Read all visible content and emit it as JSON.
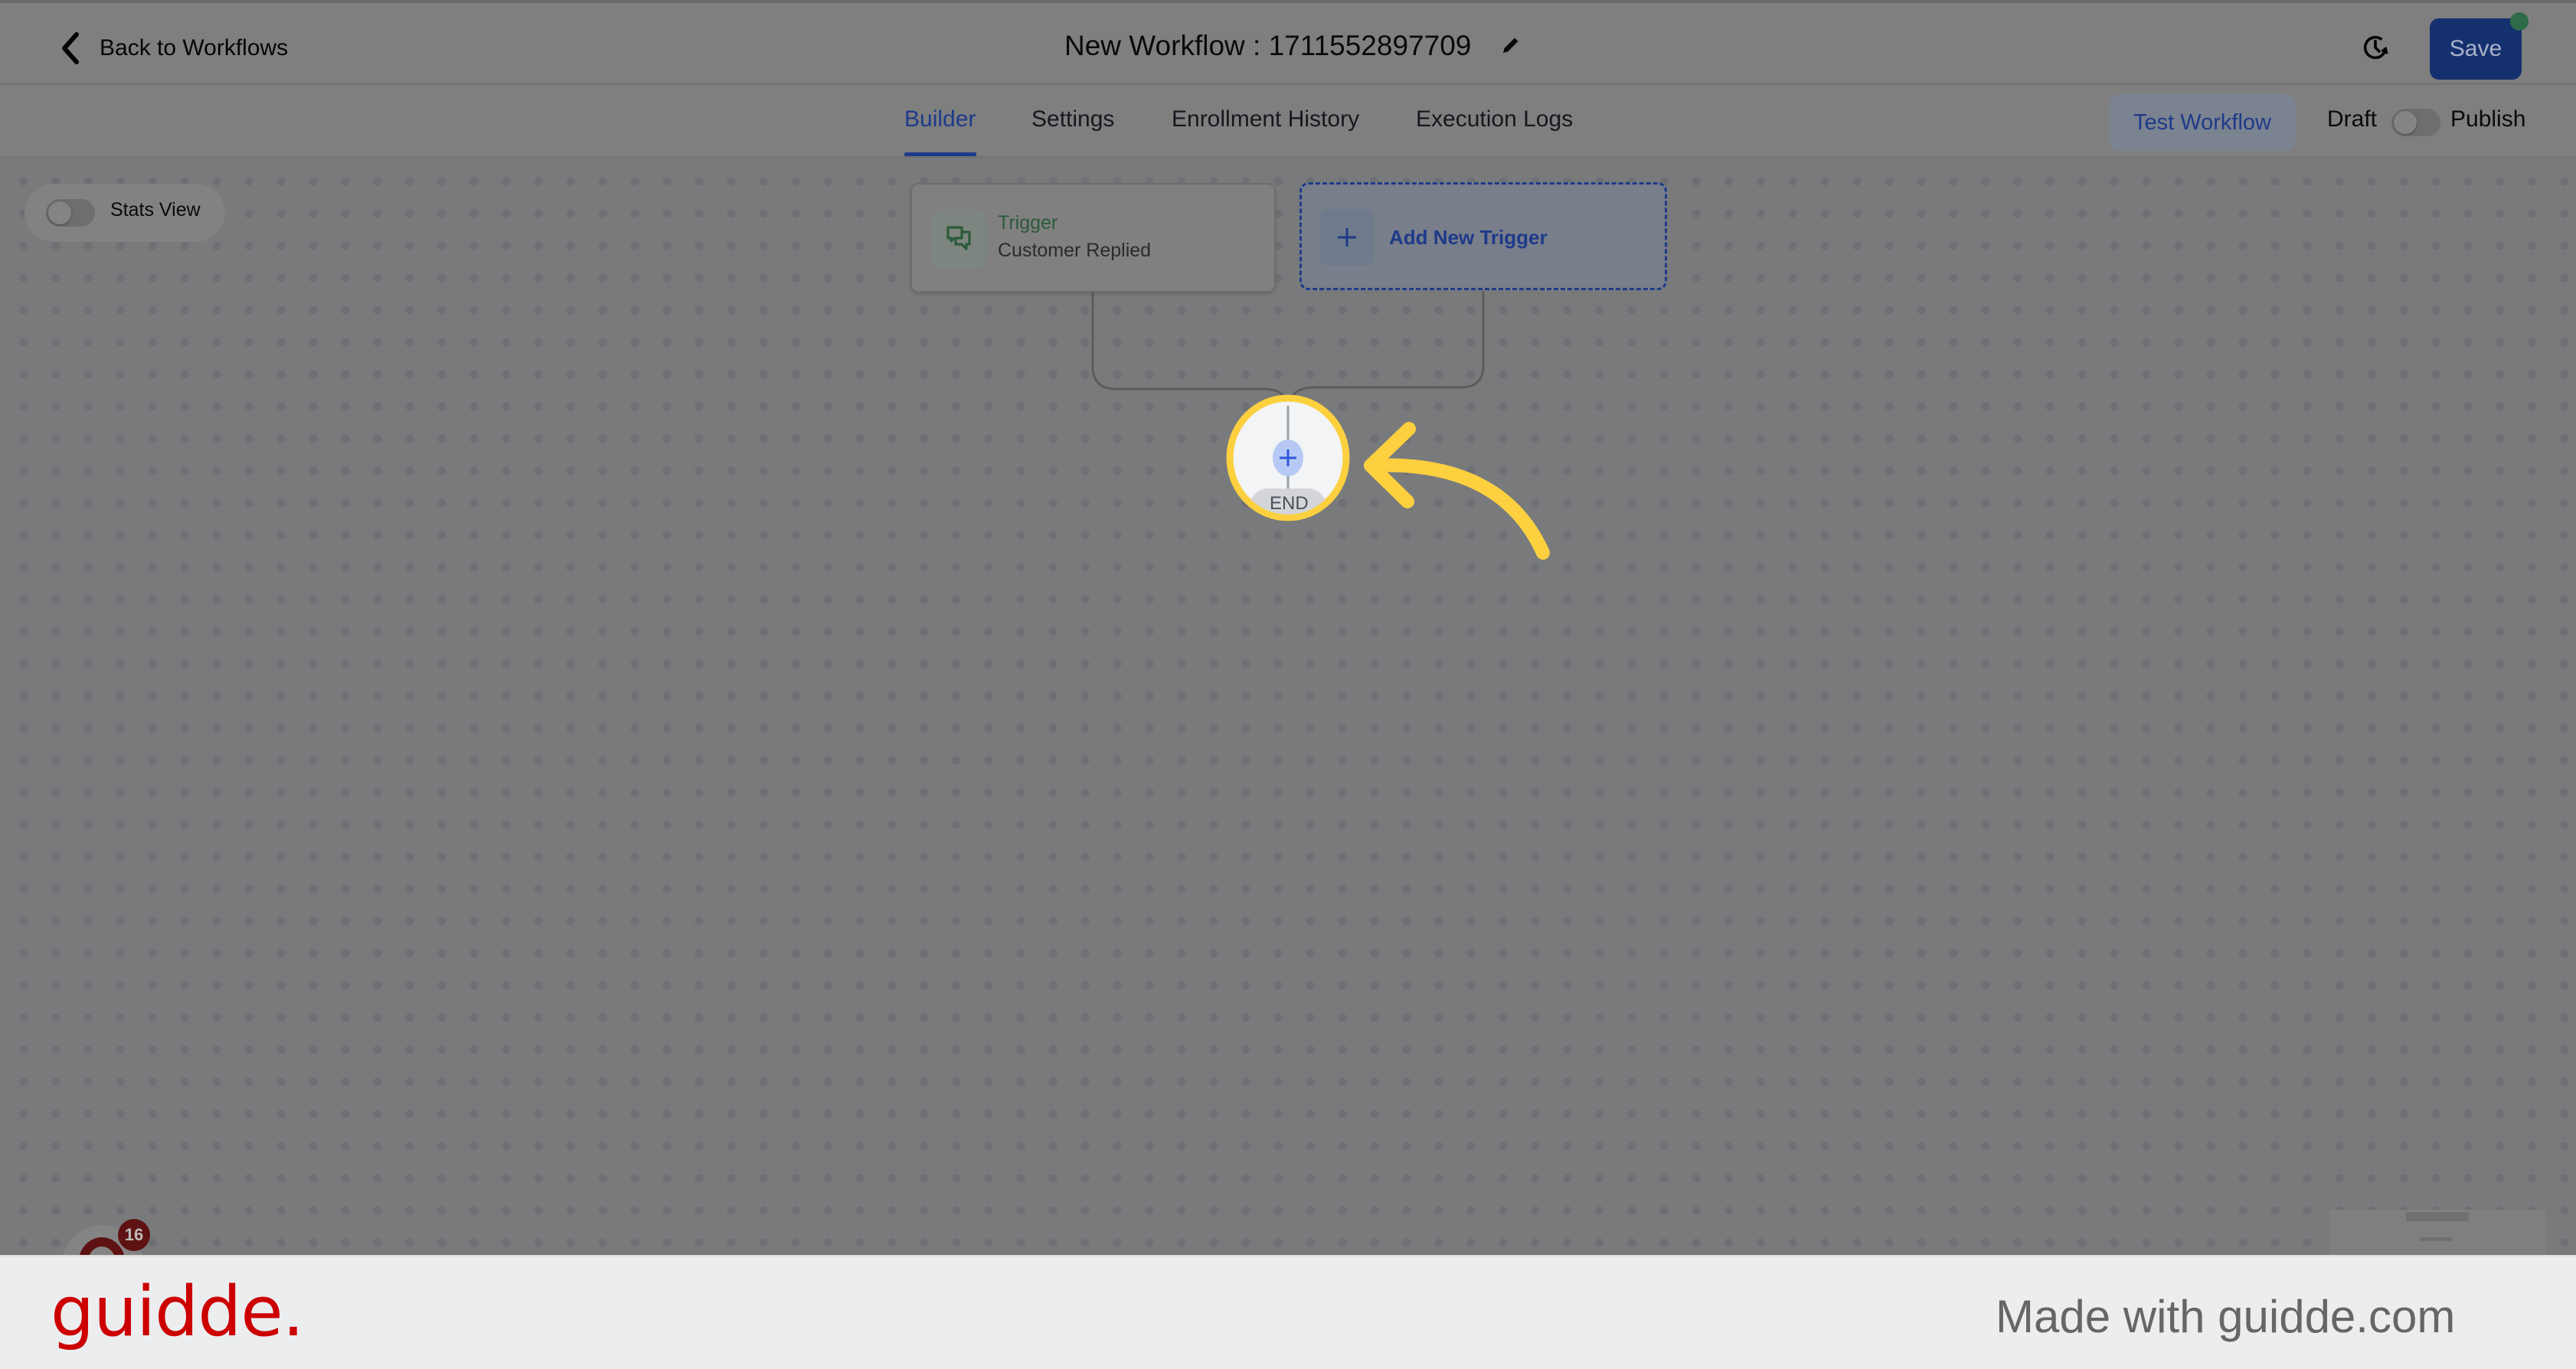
{
  "header": {
    "back_label": "Back to Workflows",
    "title": "New Workflow : 1711552897709",
    "save_label": "Save",
    "save_color": "#15306f",
    "unsaved_dot_color": "#2e6b48"
  },
  "tabs": [
    {
      "label": "Builder",
      "active": true
    },
    {
      "label": "Settings",
      "active": false
    },
    {
      "label": "Enrollment History",
      "active": false
    },
    {
      "label": "Execution Logs",
      "active": false
    }
  ],
  "actions": {
    "test_workflow_label": "Test Workflow",
    "draft_label": "Draft",
    "publish_label": "Publish",
    "publish_toggle_on": false
  },
  "canvas": {
    "stats_view_label": "Stats View",
    "stats_view_on": false,
    "trigger": {
      "title": "Trigger",
      "subtitle": "Customer Replied",
      "icon": "chat-bubbles-icon"
    },
    "add_trigger_label": "Add New Trigger",
    "end_label": "END",
    "highlight_color": "#fcd03f"
  },
  "help_widget": {
    "badge_count": "16"
  },
  "footer": {
    "logo_text": "guidde.",
    "made_with_text": "Made with guidde.com",
    "logo_color": "#cc0000"
  }
}
